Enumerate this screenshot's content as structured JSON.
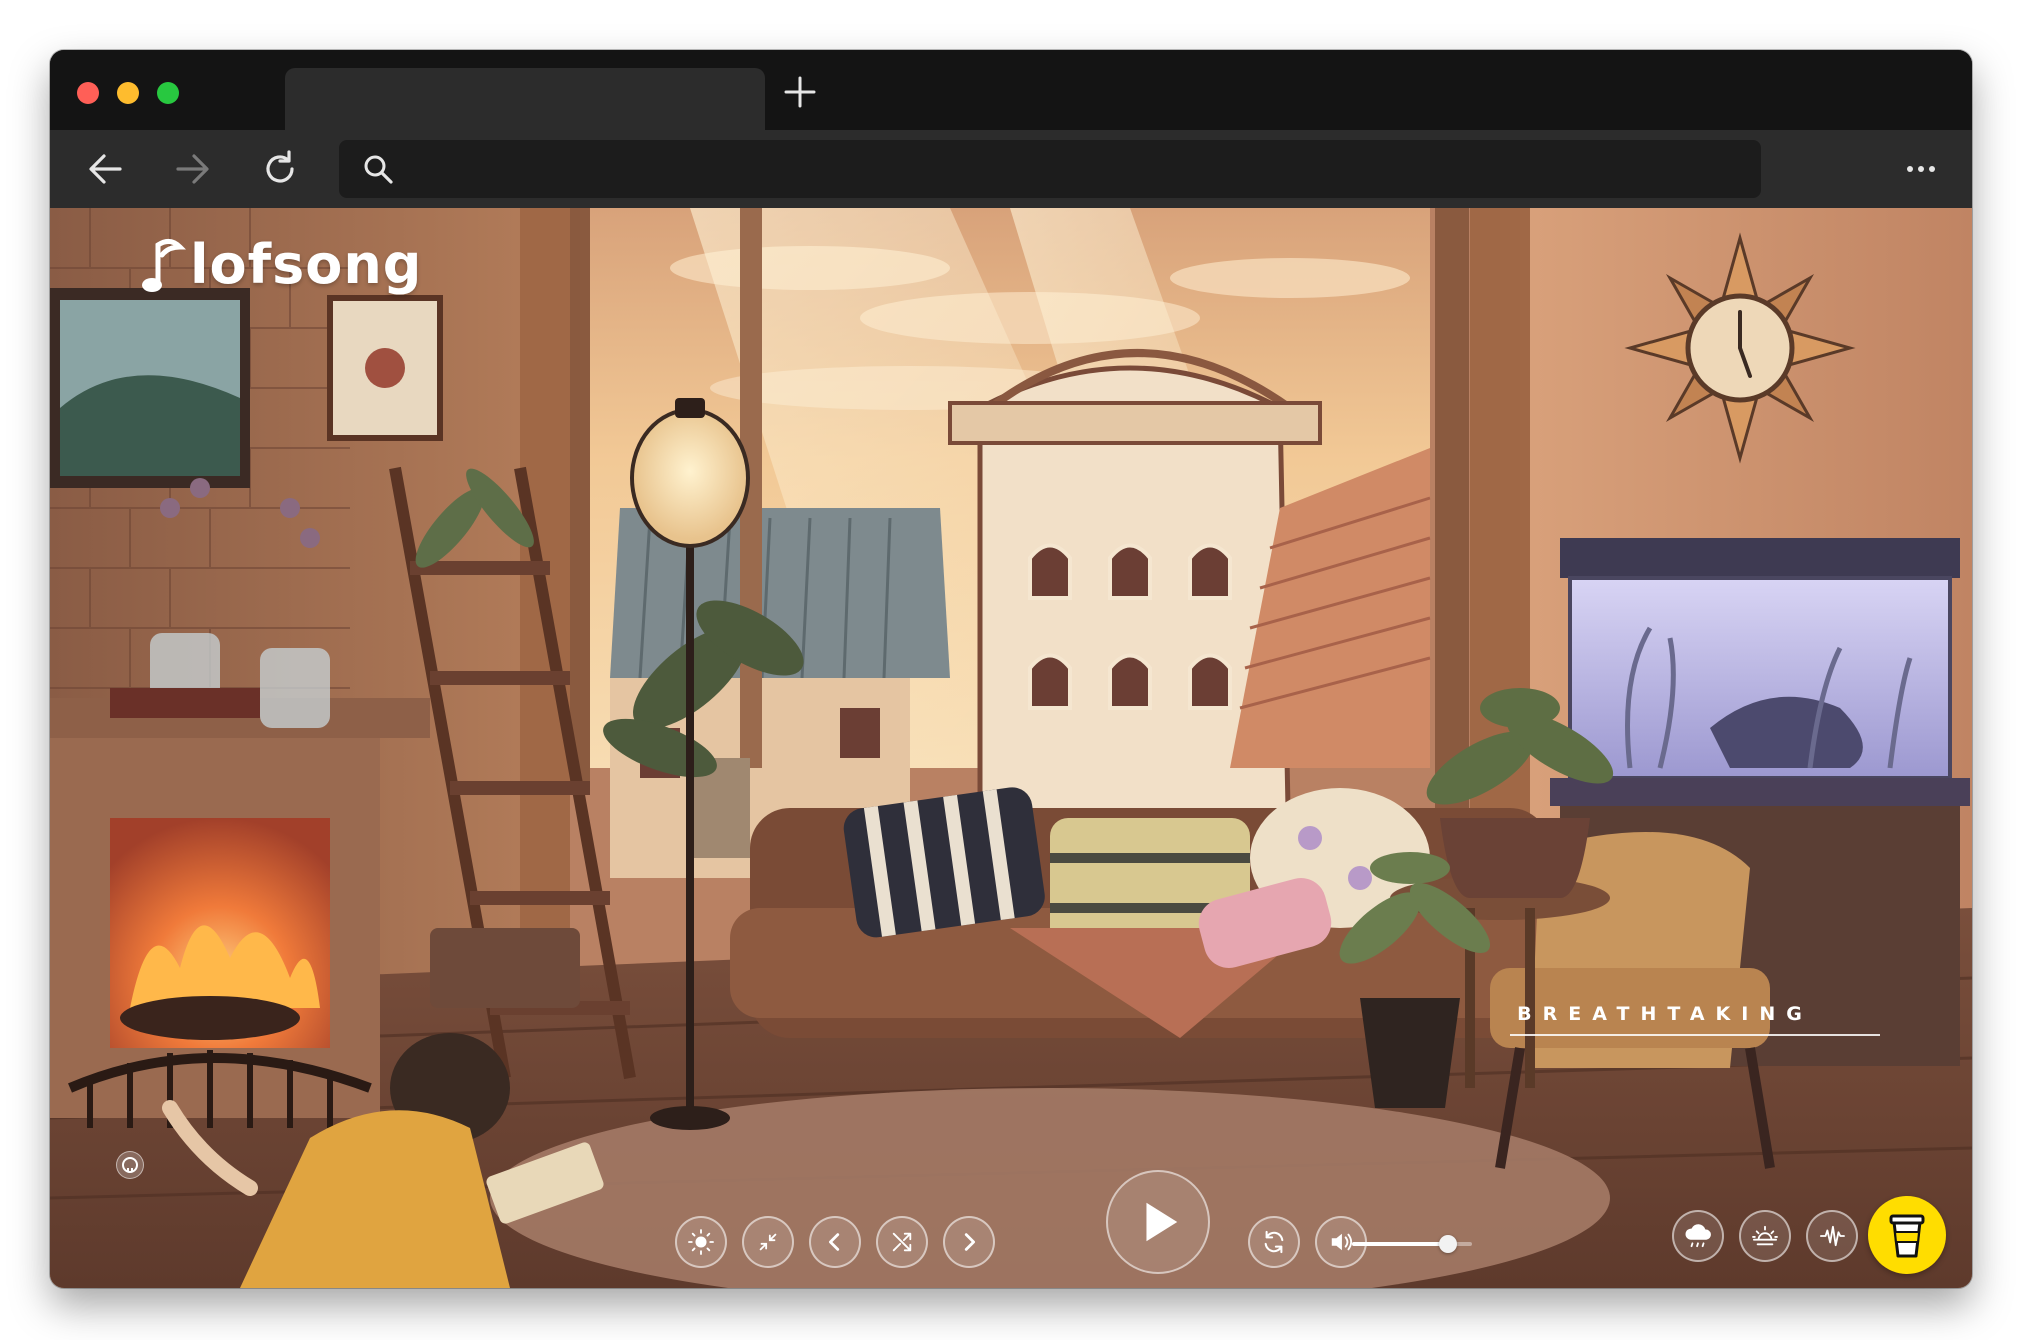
{
  "browser": {
    "traffic_lights": [
      "close",
      "minimize",
      "maximize"
    ],
    "new_tab_icon": "plus-icon",
    "nav": {
      "back_icon": "arrow-left-icon",
      "forward_icon": "arrow-right-icon",
      "reload_icon": "reload-icon"
    },
    "address_bar": {
      "value": "",
      "placeholder": "",
      "icon": "search-icon"
    },
    "menu_icon": "more-horizontal-icon"
  },
  "app": {
    "logo_text": "lofsong",
    "track_title": "BREATHTAKING",
    "background_scene": "cozy lofi living room illustration",
    "controls": {
      "left": [
        {
          "name": "brightness-button",
          "icon": "sun-icon"
        },
        {
          "name": "minimize-screen-button",
          "icon": "shrink-icon"
        },
        {
          "name": "previous-button",
          "icon": "chevron-left-icon"
        },
        {
          "name": "shuffle-button",
          "icon": "shuffle-icon"
        },
        {
          "name": "next-button",
          "icon": "chevron-right-icon"
        }
      ],
      "play": {
        "name": "play-button",
        "icon": "play-icon"
      },
      "right": [
        {
          "name": "repeat-button",
          "icon": "repeat-icon"
        },
        {
          "name": "volume-button",
          "icon": "speaker-icon"
        }
      ],
      "volume_level": 0.8
    },
    "ambient_buttons": [
      {
        "name": "rain-button",
        "icon": "cloud-rain-icon"
      },
      {
        "name": "sunrise-button",
        "icon": "sunrise-icon"
      },
      {
        "name": "waveform-button",
        "icon": "waveform-icon"
      }
    ],
    "coffee_button": {
      "icon": "coffee-cup-icon",
      "color": "#ffdd00"
    },
    "github_icon": "github-icon"
  },
  "colors": {
    "browser_frame": "#141414",
    "toolbar": "#2c2c2c",
    "accent_yellow": "#ffdd00",
    "scene_warm": "#c08a62"
  }
}
